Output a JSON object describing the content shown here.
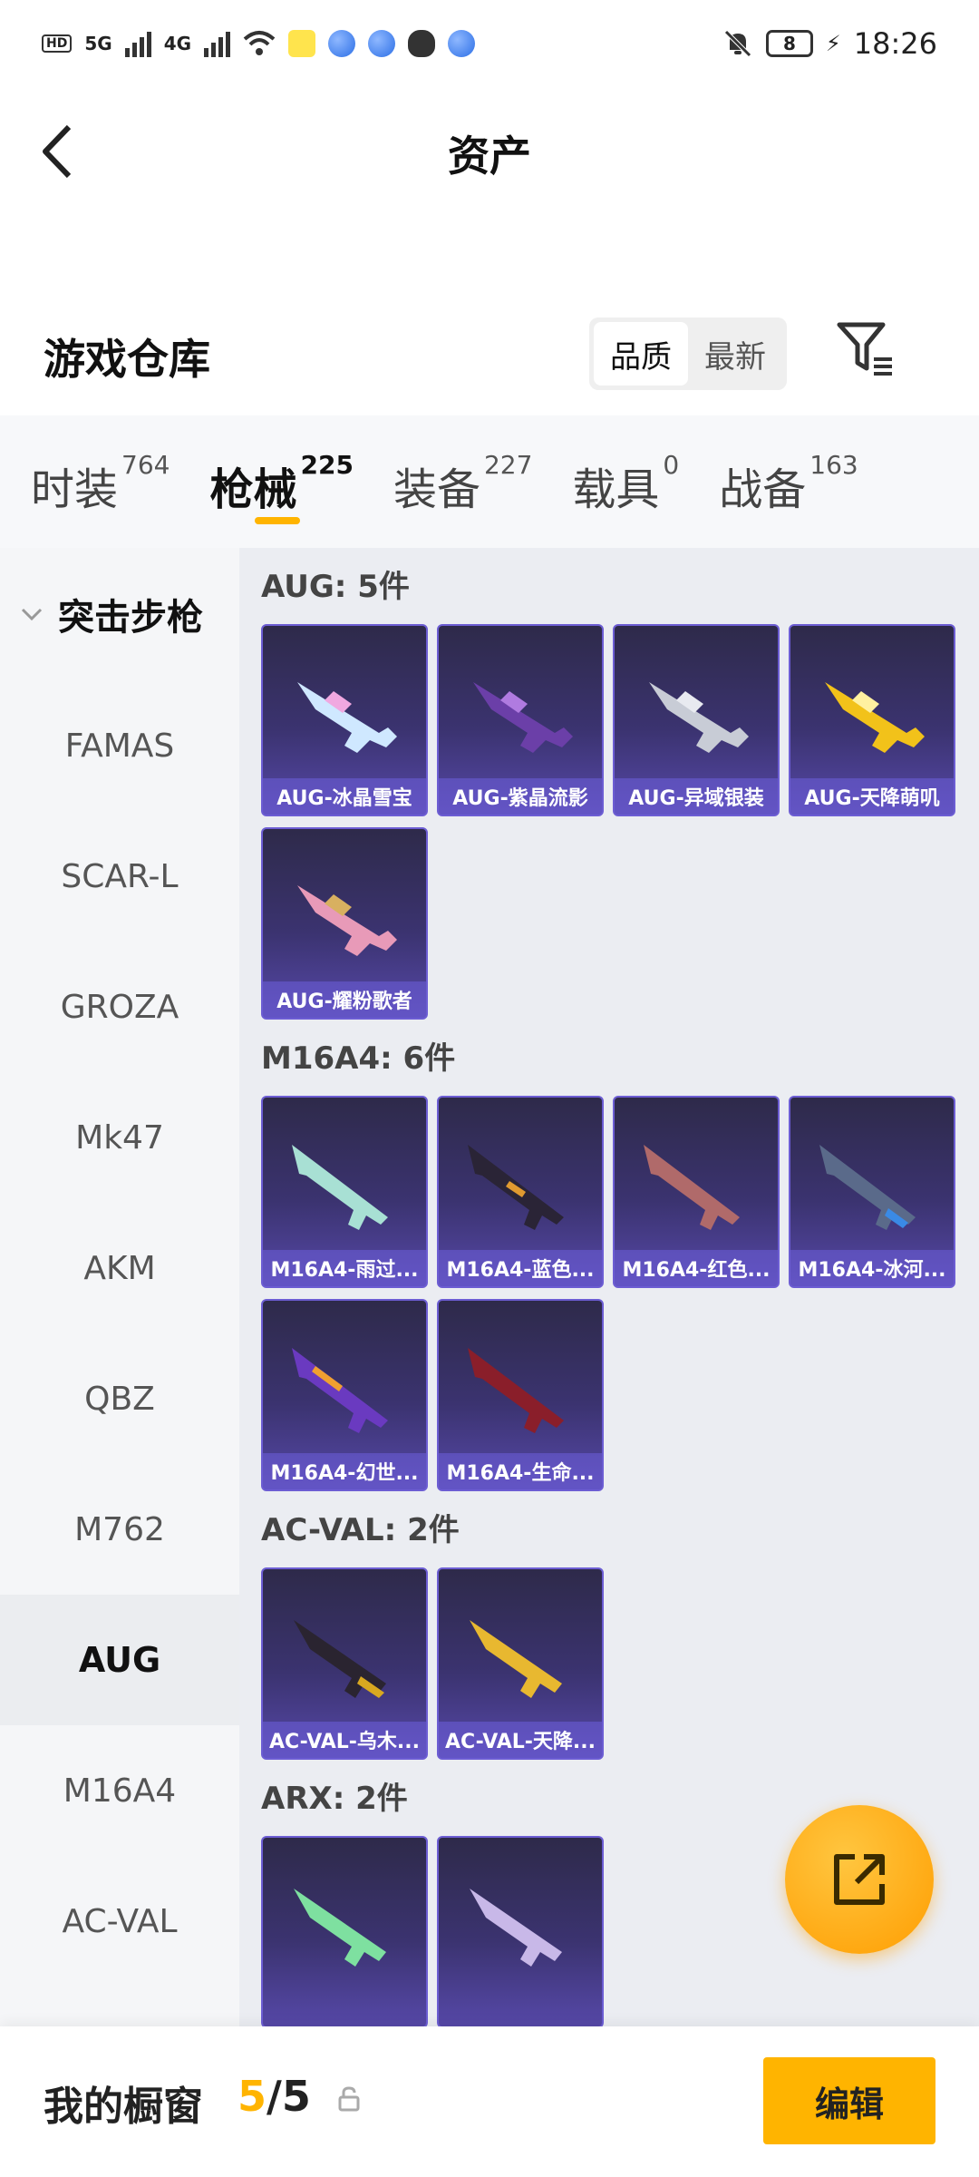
{
  "status_bar": {
    "network_left": "5G",
    "network_right": "4G",
    "battery_level": "8",
    "time": "18:26"
  },
  "header": {
    "title": "资产"
  },
  "warehouse": {
    "title": "游戏仓库",
    "sort_options": [
      "品质",
      "最新"
    ],
    "sort_selected": "品质"
  },
  "tabs": [
    {
      "label": "时装",
      "count": "764"
    },
    {
      "label": "枪械",
      "count": "225"
    },
    {
      "label": "装备",
      "count": "227"
    },
    {
      "label": "载具",
      "count": "0"
    },
    {
      "label": "战备",
      "count": "163"
    }
  ],
  "sidebar": {
    "category": "突击步枪",
    "items": [
      "FAMAS",
      "SCAR-L",
      "GROZA",
      "Mk47",
      "AKM",
      "QBZ",
      "M762",
      "AUG",
      "M16A4",
      "AC-VAL"
    ],
    "selected": "AUG"
  },
  "groups": [
    {
      "title": "AUG: 5件",
      "items": [
        "AUG-冰晶雪宝",
        "AUG-紫晶流影",
        "AUG-异域银装",
        "AUG-天降萌叽",
        "AUG-耀粉歌者"
      ]
    },
    {
      "title": "M16A4: 6件",
      "items": [
        "M16A4-雨过...",
        "M16A4-蓝色...",
        "M16A4-红色...",
        "M16A4-冰河...",
        "M16A4-幻世...",
        "M16A4-生命..."
      ]
    },
    {
      "title": "AC-VAL: 2件",
      "items": [
        "AC-VAL-乌木...",
        "AC-VAL-天降..."
      ]
    },
    {
      "title": "ARX: 2件",
      "items": [
        "",
        ""
      ]
    }
  ],
  "bottom_bar": {
    "showcase_label": "我的橱窗",
    "showcase_current": "5",
    "showcase_separator": "/",
    "showcase_total": "5",
    "edit_label": "编辑"
  },
  "colors": {
    "accent": "#ffb400",
    "card_bg_top": "#2e2a4a",
    "card_bg_bottom": "#5648a8"
  },
  "icons": [
    "back-arrow-icon",
    "filter-icon",
    "chevron-down-icon",
    "share-external-icon",
    "lock-icon",
    "mute-bell-icon",
    "battery-icon",
    "wifi-icon"
  ]
}
